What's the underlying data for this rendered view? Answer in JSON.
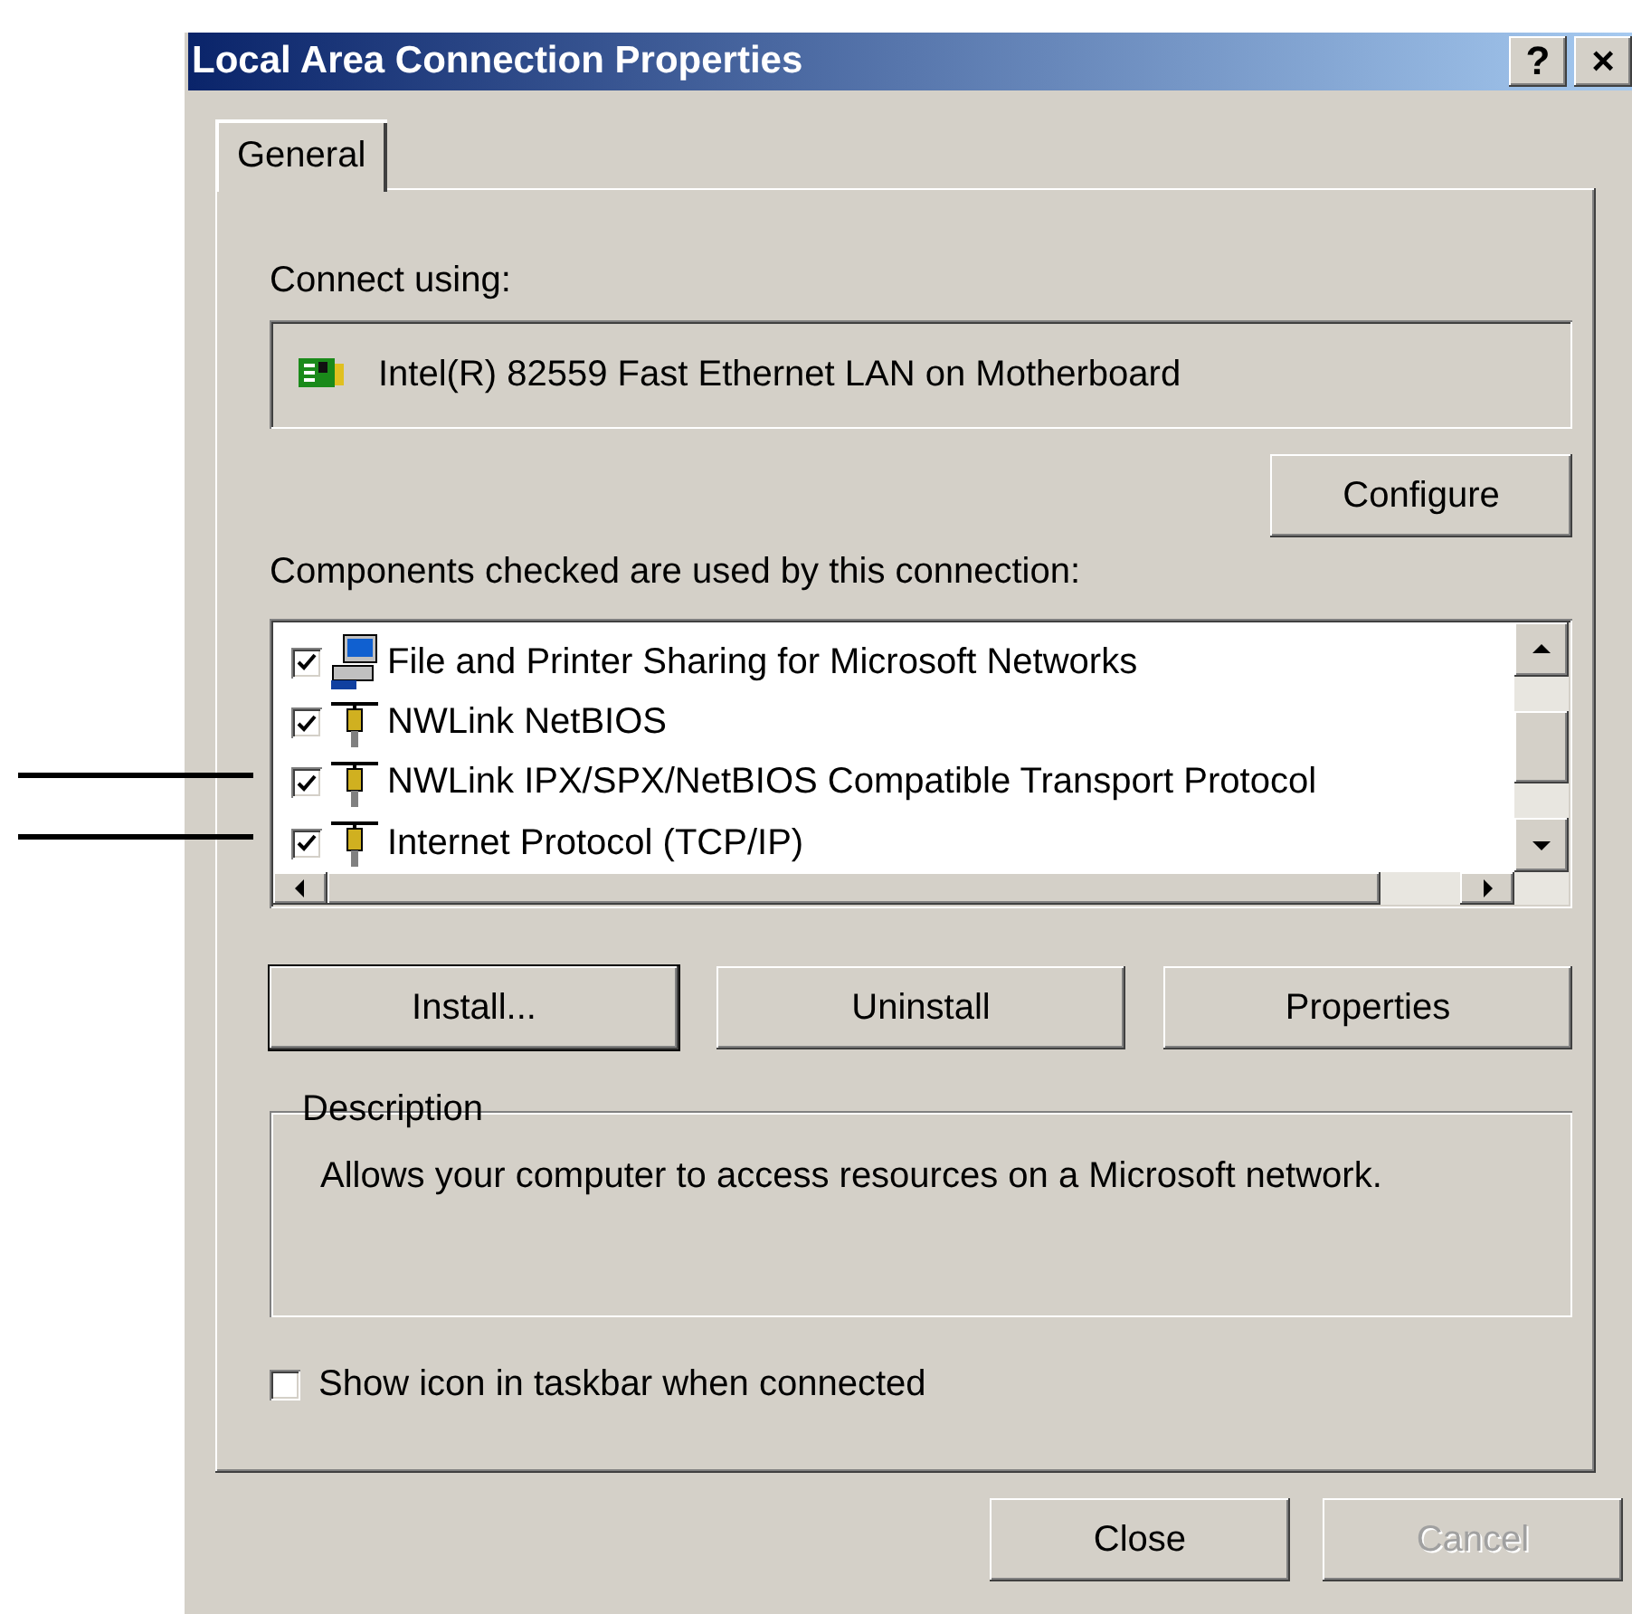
{
  "window": {
    "title": "Local Area Connection Properties",
    "help_button": "?",
    "close_button": "×"
  },
  "tabs": [
    {
      "label": "General",
      "selected": true
    }
  ],
  "connect_using": {
    "label": "Connect using:",
    "adapter": "Intel(R) 82559 Fast Ethernet LAN on Motherboard",
    "configure_button": "Configure"
  },
  "components": {
    "label": "Components checked are used by this connection:",
    "items": [
      {
        "name": "File and Printer Sharing for Microsoft Networks",
        "checked": true,
        "kind": "service"
      },
      {
        "name": "NWLink NetBIOS",
        "checked": true,
        "kind": "protocol"
      },
      {
        "name": "NWLink IPX/SPX/NetBIOS Compatible Transport Protocol",
        "checked": true,
        "kind": "protocol"
      },
      {
        "name": "Internet Protocol (TCP/IP)",
        "checked": true,
        "kind": "protocol"
      }
    ]
  },
  "component_buttons": [
    {
      "label": "Install...",
      "disabled": false
    },
    {
      "label": "Uninstall",
      "disabled": false
    },
    {
      "label": "Properties",
      "disabled": false
    }
  ],
  "description": {
    "title": "Description",
    "text": "Allows your computer to access resources on a Microsoft network."
  },
  "show_icon": {
    "label": "Show icon in taskbar when connected",
    "checked": false
  },
  "dialog_buttons": [
    {
      "label": "Close",
      "disabled": false
    },
    {
      "label": "Cancel",
      "disabled": true
    }
  ]
}
